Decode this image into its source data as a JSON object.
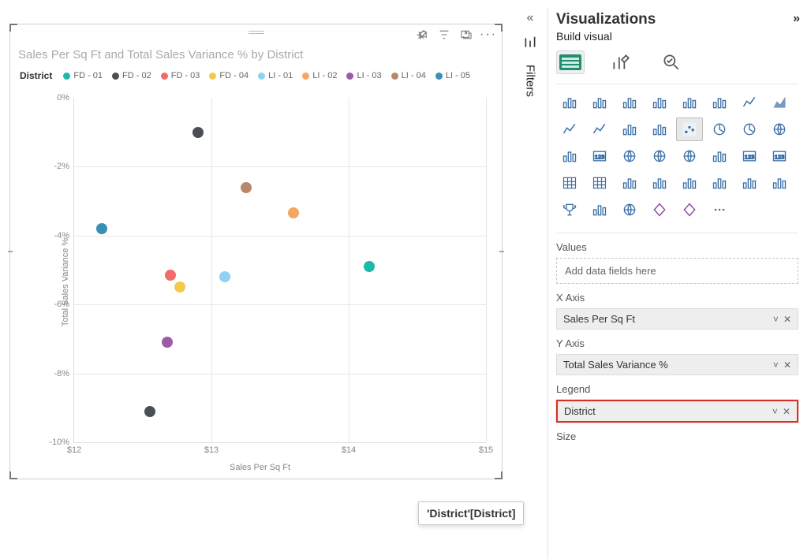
{
  "chart_data": {
    "type": "scatter",
    "title": "Sales Per Sq Ft and Total Sales Variance % by District",
    "xlabel": "Sales Per Sq Ft",
    "ylabel": "Total Sales Variance %",
    "xlim": [
      12,
      15
    ],
    "ylim": [
      -10,
      0
    ],
    "xticks": [
      "$12",
      "$13",
      "$14",
      "$15"
    ],
    "yticks": [
      "0%",
      "-2%",
      "-4%",
      "-6%",
      "-8%",
      "-10%"
    ],
    "legend_title": "District",
    "series": [
      {
        "name": "FD - 01",
        "color": "#20b9a5",
        "points": [
          {
            "x": 14.15,
            "y": -4.9
          }
        ]
      },
      {
        "name": "FD - 02",
        "color": "#4a4e55",
        "points": [
          {
            "x": 12.55,
            "y": -9.1
          },
          {
            "x": 12.9,
            "y": -1.0
          }
        ]
      },
      {
        "name": "FD - 03",
        "color": "#f26b6b",
        "points": [
          {
            "x": 12.7,
            "y": -5.15
          }
        ]
      },
      {
        "name": "FD - 04",
        "color": "#f2c94c",
        "points": [
          {
            "x": 12.77,
            "y": -5.5
          }
        ]
      },
      {
        "name": "LI - 01",
        "color": "#8ed1f0",
        "points": [
          {
            "x": 13.1,
            "y": -5.2
          }
        ]
      },
      {
        "name": "LI - 02",
        "color": "#f5a661",
        "points": [
          {
            "x": 13.6,
            "y": -3.35
          }
        ]
      },
      {
        "name": "LI - 03",
        "color": "#9b5ba5",
        "points": [
          {
            "x": 12.68,
            "y": -7.1
          }
        ]
      },
      {
        "name": "LI - 04",
        "color": "#b58a6b",
        "points": [
          {
            "x": 13.25,
            "y": -2.6
          }
        ]
      },
      {
        "name": "LI - 05",
        "color": "#3a8fb7",
        "points": [
          {
            "x": 12.2,
            "y": -3.8
          }
        ]
      }
    ]
  },
  "side": {
    "collapse_aria": "«",
    "filters_label": "Filters"
  },
  "viz": {
    "panel_title": "Visualizations",
    "subtitle": "Build visual",
    "expand_aria": "»",
    "tabs": [
      {
        "name": "build-visual-tab",
        "active": true
      },
      {
        "name": "format-visual-tab",
        "active": false
      },
      {
        "name": "analytics-tab",
        "active": false
      }
    ],
    "gallery_selected": "scatter-chart",
    "gallery": [
      "stacked-bar",
      "clustered-bar",
      "stacked-column",
      "clustered-column",
      "stacked-bar-100",
      "clustered-column-line",
      "line",
      "area",
      "line-stacked",
      "line-clustered",
      "waterfall",
      "funnel",
      "scatter-chart",
      "pie",
      "donut",
      "treemap",
      "gauge",
      "card2",
      "map",
      "filled-map",
      "azure-map",
      "gauge2",
      "kpi",
      "slicer",
      "table",
      "matrix",
      "r",
      "py",
      "decomp",
      "key-influencers",
      "chat",
      "paginated",
      "trophy",
      "bar-small",
      "map2",
      "powerapps",
      "powerautomate",
      "more"
    ],
    "fields": {
      "values": {
        "label": "Values",
        "placeholder": "Add data fields here"
      },
      "xaxis": {
        "label": "X Axis",
        "value": "Sales Per Sq Ft"
      },
      "yaxis": {
        "label": "Y Axis",
        "value": "Total Sales Variance %"
      },
      "legend": {
        "label": "Legend",
        "value": "District"
      },
      "size": {
        "label": "Size"
      }
    }
  },
  "drag_tooltip": "'District'[District]"
}
